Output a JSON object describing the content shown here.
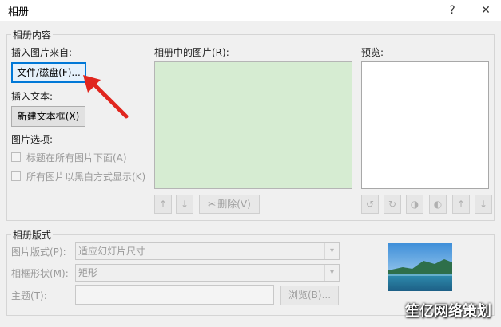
{
  "window": {
    "title": "相册",
    "help_glyph": "?",
    "close_glyph": "✕"
  },
  "album_content": {
    "group_label": "相册内容",
    "insert_picture_from_label": "插入图片来自:",
    "file_disk_button": "文件/磁盘(F)...",
    "insert_text_label": "插入文本:",
    "new_textbox_button": "新建文本框(X)",
    "picture_options_label": "图片选项:",
    "caption_below_label": "标题在所有图片下面(A)",
    "all_black_white_label": "所有图片以黑白方式显示(K)",
    "pictures_in_album_label": "相册中的图片(R):",
    "preview_label": "预览:",
    "remove_button": "删除(V)"
  },
  "album_layout": {
    "group_label": "相册版式",
    "picture_layout_label": "图片版式(P):",
    "picture_layout_value": "适应幻灯片尺寸",
    "frame_shape_label": "相框形状(M):",
    "frame_shape_value": "矩形",
    "theme_label": "主题(T):",
    "theme_value": "",
    "browse_button": "浏览(B)..."
  },
  "watermark": "笙亿网络策划",
  "icons": [
    "up-arrow-icon",
    "down-arrow-icon",
    "remove-icon",
    "rotate-left-icon",
    "rotate-right-icon",
    "contrast-up-icon",
    "contrast-down-icon",
    "brightness-up-icon",
    "brightness-down-icon",
    "red-arrow-annotation"
  ]
}
